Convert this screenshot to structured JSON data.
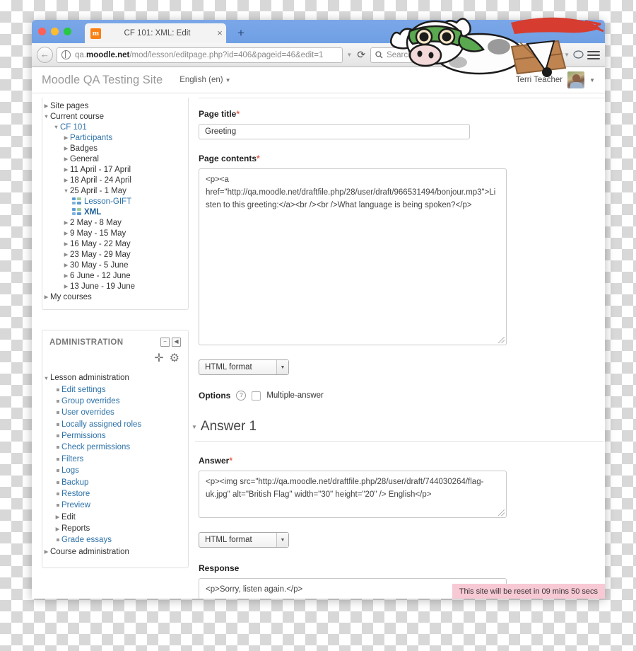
{
  "browser": {
    "tab": {
      "title": "CF 101: XML: Edit",
      "favicon": "moodle-m-icon",
      "close_label": "×"
    },
    "new_tab_label": "+",
    "url_prefix": "qa.",
    "url_brand": "moodle.net",
    "url_rest": "/mod/lesson/editpage.php?id=406&pageid=46&edit=1",
    "reload_label": "⟳",
    "search_placeholder": "Search",
    "toolbar_icons": [
      "download-icon",
      "home-icon",
      "bookmark-star-icon",
      "reader-view-icon",
      "pocket-icon",
      "sync-icon",
      "chat-icon",
      "menu-icon"
    ]
  },
  "moodle_header": {
    "site_name": "Moodle QA Testing Site",
    "language": "English (en)",
    "user_name": "Terri Teacher"
  },
  "sidebar": {
    "nav_tree": [
      {
        "label": "Site pages",
        "indent": 0,
        "arrow": "collapsed",
        "style": "plain"
      },
      {
        "label": "Current course",
        "indent": 0,
        "arrow": "expanded",
        "style": "plain"
      },
      {
        "label": "CF 101",
        "indent": 1,
        "arrow": "expanded",
        "style": "link"
      },
      {
        "label": "Participants",
        "indent": 2,
        "arrow": "collapsed",
        "style": "link"
      },
      {
        "label": "Badges",
        "indent": 2,
        "arrow": "collapsed",
        "style": "plain"
      },
      {
        "label": "General",
        "indent": 2,
        "arrow": "collapsed",
        "style": "plain"
      },
      {
        "label": "11 April - 17 April",
        "indent": 2,
        "arrow": "collapsed",
        "style": "plain"
      },
      {
        "label": "18 April - 24 April",
        "indent": 2,
        "arrow": "collapsed",
        "style": "plain"
      },
      {
        "label": "25 April - 1 May",
        "indent": 2,
        "arrow": "expanded",
        "style": "plain"
      },
      {
        "label": "Lesson-GIFT",
        "indent": 3,
        "arrow": "icon",
        "style": "link"
      },
      {
        "label": "XML",
        "indent": 3,
        "arrow": "icon",
        "style": "active"
      },
      {
        "label": "2 May - 8 May",
        "indent": 2,
        "arrow": "collapsed",
        "style": "plain"
      },
      {
        "label": "9 May - 15 May",
        "indent": 2,
        "arrow": "collapsed",
        "style": "plain"
      },
      {
        "label": "16 May - 22 May",
        "indent": 2,
        "arrow": "collapsed",
        "style": "plain"
      },
      {
        "label": "23 May - 29 May",
        "indent": 2,
        "arrow": "collapsed",
        "style": "plain"
      },
      {
        "label": "30 May - 5 June",
        "indent": 2,
        "arrow": "collapsed",
        "style": "plain"
      },
      {
        "label": "6 June - 12 June",
        "indent": 2,
        "arrow": "collapsed",
        "style": "plain"
      },
      {
        "label": "13 June - 19 June",
        "indent": 2,
        "arrow": "collapsed",
        "style": "plain"
      },
      {
        "label": "My courses",
        "indent": 0,
        "arrow": "collapsed",
        "style": "plain"
      }
    ],
    "admin_block": {
      "title": "ADMINISTRATION",
      "dock_icon": "−",
      "collapse_icon": "◀",
      "move_icon": "✛",
      "gear_icon": "⚙",
      "items": [
        {
          "label": "Lesson administration",
          "indent": 0,
          "arrow": "expanded",
          "style": "plain"
        },
        {
          "label": "Edit settings",
          "indent": 1,
          "arrow": "bullet",
          "style": "link"
        },
        {
          "label": "Group overrides",
          "indent": 1,
          "arrow": "bullet",
          "style": "link"
        },
        {
          "label": "User overrides",
          "indent": 1,
          "arrow": "bullet",
          "style": "link"
        },
        {
          "label": "Locally assigned roles",
          "indent": 1,
          "arrow": "bullet",
          "style": "link"
        },
        {
          "label": "Permissions",
          "indent": 1,
          "arrow": "bullet",
          "style": "link"
        },
        {
          "label": "Check permissions",
          "indent": 1,
          "arrow": "bullet",
          "style": "link"
        },
        {
          "label": "Filters",
          "indent": 1,
          "arrow": "bullet",
          "style": "link"
        },
        {
          "label": "Logs",
          "indent": 1,
          "arrow": "bullet",
          "style": "link"
        },
        {
          "label": "Backup",
          "indent": 1,
          "arrow": "bullet",
          "style": "link"
        },
        {
          "label": "Restore",
          "indent": 1,
          "arrow": "bullet",
          "style": "link"
        },
        {
          "label": "Preview",
          "indent": 1,
          "arrow": "bullet",
          "style": "link"
        },
        {
          "label": "Edit",
          "indent": 1,
          "arrow": "collapsed",
          "style": "plain"
        },
        {
          "label": "Reports",
          "indent": 1,
          "arrow": "collapsed",
          "style": "plain"
        },
        {
          "label": "Grade essays",
          "indent": 1,
          "arrow": "bullet",
          "style": "link"
        },
        {
          "label": "Course administration",
          "indent": 0,
          "arrow": "collapsed",
          "style": "plain"
        }
      ]
    }
  },
  "form": {
    "page_title_label": "Page title",
    "page_title_value": "Greeting",
    "page_contents_label": "Page contents",
    "page_contents_value": "<p><a href=\"http://qa.moodle.net/draftfile.php/28/user/draft/966531494/bonjour.mp3\">Listen to this greeting:</a><br /><br />What language is being spoken?</p>",
    "format_select_1": "HTML format",
    "options_label": "Options",
    "help_icon_label": "?",
    "multiple_answer_label": "Multiple-answer",
    "multiple_answer_checked": false,
    "answer_section_title": "Answer 1",
    "answer_label": "Answer",
    "answer_value": "<p><img src=\"http://qa.moodle.net/draftfile.php/28/user/draft/744030264/flag-uk.jpg\" alt=\"British Flag\" width=\"30\" height=\"20\" /> English</p>",
    "format_select_2": "HTML format",
    "response_label": "Response",
    "response_value": "<p>Sorry, listen again.</p>",
    "required_marker": "*"
  },
  "notice": {
    "reset_message": "This site will be reset in 09 mins 50 secs",
    "reset_bg": "#f7c9d5"
  },
  "colors": {
    "link": "#2d72a8",
    "required": "#e8604c",
    "chrome_blue": "#7ba7e8"
  }
}
